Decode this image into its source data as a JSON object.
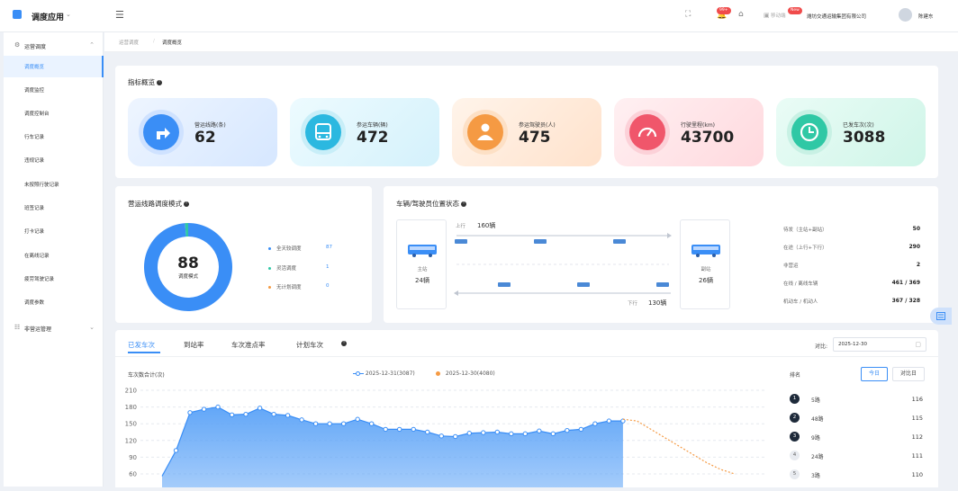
{
  "topbar": {
    "app_title": "调度应用",
    "badge_messages": "99+",
    "badge_new": "New",
    "workspace_label": "移动端",
    "org_name": "潍坊交通运输集团有限公司",
    "user_name": "陈建东"
  },
  "sidebar": {
    "group1": "运营调度",
    "items": [
      "调度概览",
      "调度监控",
      "调度控制台",
      "行车记录",
      "违规记录",
      "未按照行驶记录",
      "班签记录",
      "打卡记录",
      "在离线记录",
      "疲劳驾驶记录",
      "调度参数"
    ],
    "active_index": 0,
    "group2": "非营运管理"
  },
  "breadcrumb": {
    "parent": "运营调度",
    "sep": "/",
    "current": "调度概览"
  },
  "overview": {
    "title": "指标概览",
    "kpis": [
      {
        "label": "营运线路(条)",
        "value": "62",
        "color": "#3a8ef6",
        "icon": "turn-right-arrow-icon"
      },
      {
        "label": "参运车辆(辆)",
        "value": "472",
        "color": "#2bb8e0",
        "icon": "bus-icon"
      },
      {
        "label": "参运驾驶员(人)",
        "value": "475",
        "color": "#f59a43",
        "icon": "driver-icon"
      },
      {
        "label": "行驶里程(km)",
        "value": "43700",
        "color": "#f0566b",
        "icon": "speedometer-icon"
      },
      {
        "label": "已发车次(次)",
        "value": "3088",
        "color": "#2fc8a5",
        "icon": "clock-icon"
      }
    ]
  },
  "dispatch_mode": {
    "title": "营运线路调度模式",
    "center_value": "88",
    "center_label": "调度模式",
    "legend": [
      {
        "label": "全天较调度",
        "value": "87",
        "color": "#3a8ef6"
      },
      {
        "label": "灵活调度",
        "value": "1",
        "color": "#2fc8a5"
      },
      {
        "label": "无计划调度",
        "value": "0",
        "color": "#f59a43"
      }
    ],
    "chart_data": {
      "type": "pie",
      "categories": [
        "全天较调度",
        "灵活调度",
        "无计划调度"
      ],
      "values": [
        87,
        1,
        0
      ],
      "title": "营运线路调度模式"
    }
  },
  "vehicle_status": {
    "title": "车辆/驾驶员位置状态",
    "main_station_label": "主站",
    "main_station_count": "24辆",
    "sub_station_label": "副站",
    "sub_station_count": "26辆",
    "up_label": "上行",
    "up_count": "160辆",
    "down_label": "下行",
    "down_count": "130辆",
    "stats": [
      {
        "label": "待发（主站+副站）",
        "value": "50"
      },
      {
        "label": "在途（上行+下行）",
        "value": "290"
      },
      {
        "label": "非营运",
        "value": "2"
      },
      {
        "label": "在线 / 离线车辆",
        "value": "461 / 369"
      },
      {
        "label": "机动车 / 机动人",
        "value": "367 / 328"
      }
    ]
  },
  "trips": {
    "tabs": [
      "已发车次",
      "到站率",
      "车次准点率",
      "计划车次"
    ],
    "active_tab": 0,
    "compare_label": "对比:",
    "compare_date": "2025-12-30",
    "chart_title": "车次数合计(次)",
    "chart_data": {
      "type": "area",
      "y_ticks": [
        210,
        180,
        150,
        120,
        90,
        60
      ],
      "ylim": [
        60,
        210
      ],
      "series": [
        {
          "name": "2025-12-31(3087)",
          "color": "#3a8ef6",
          "values": [
            56,
            102,
            170,
            176,
            180,
            166,
            167,
            178,
            167,
            165,
            157,
            150,
            150,
            150,
            158,
            150,
            140,
            140,
            140,
            135,
            128,
            127,
            133,
            134,
            135,
            132,
            132,
            137,
            132,
            138,
            140,
            150,
            155,
            155
          ]
        },
        {
          "name": "2025-12-30(4080)",
          "color": "#f59a43",
          "values": [
            null,
            null,
            null,
            null,
            null,
            null,
            null,
            null,
            null,
            null,
            null,
            null,
            null,
            null,
            null,
            null,
            null,
            null,
            null,
            null,
            null,
            null,
            null,
            null,
            null,
            null,
            null,
            null,
            null,
            null,
            null,
            null,
            null,
            158,
            155,
            140,
            125,
            110,
            95,
            80,
            68,
            60
          ]
        }
      ]
    },
    "ranking": {
      "title": "排名",
      "btn_today": "今日",
      "btn_compare": "对比日",
      "rows": [
        {
          "rank": "1",
          "name": "5路",
          "value": "116"
        },
        {
          "rank": "2",
          "name": "48路",
          "value": "115"
        },
        {
          "rank": "3",
          "name": "9路",
          "value": "112"
        },
        {
          "rank": "4",
          "name": "24路",
          "value": "111"
        },
        {
          "rank": "5",
          "name": "3路",
          "value": "110"
        }
      ]
    }
  }
}
